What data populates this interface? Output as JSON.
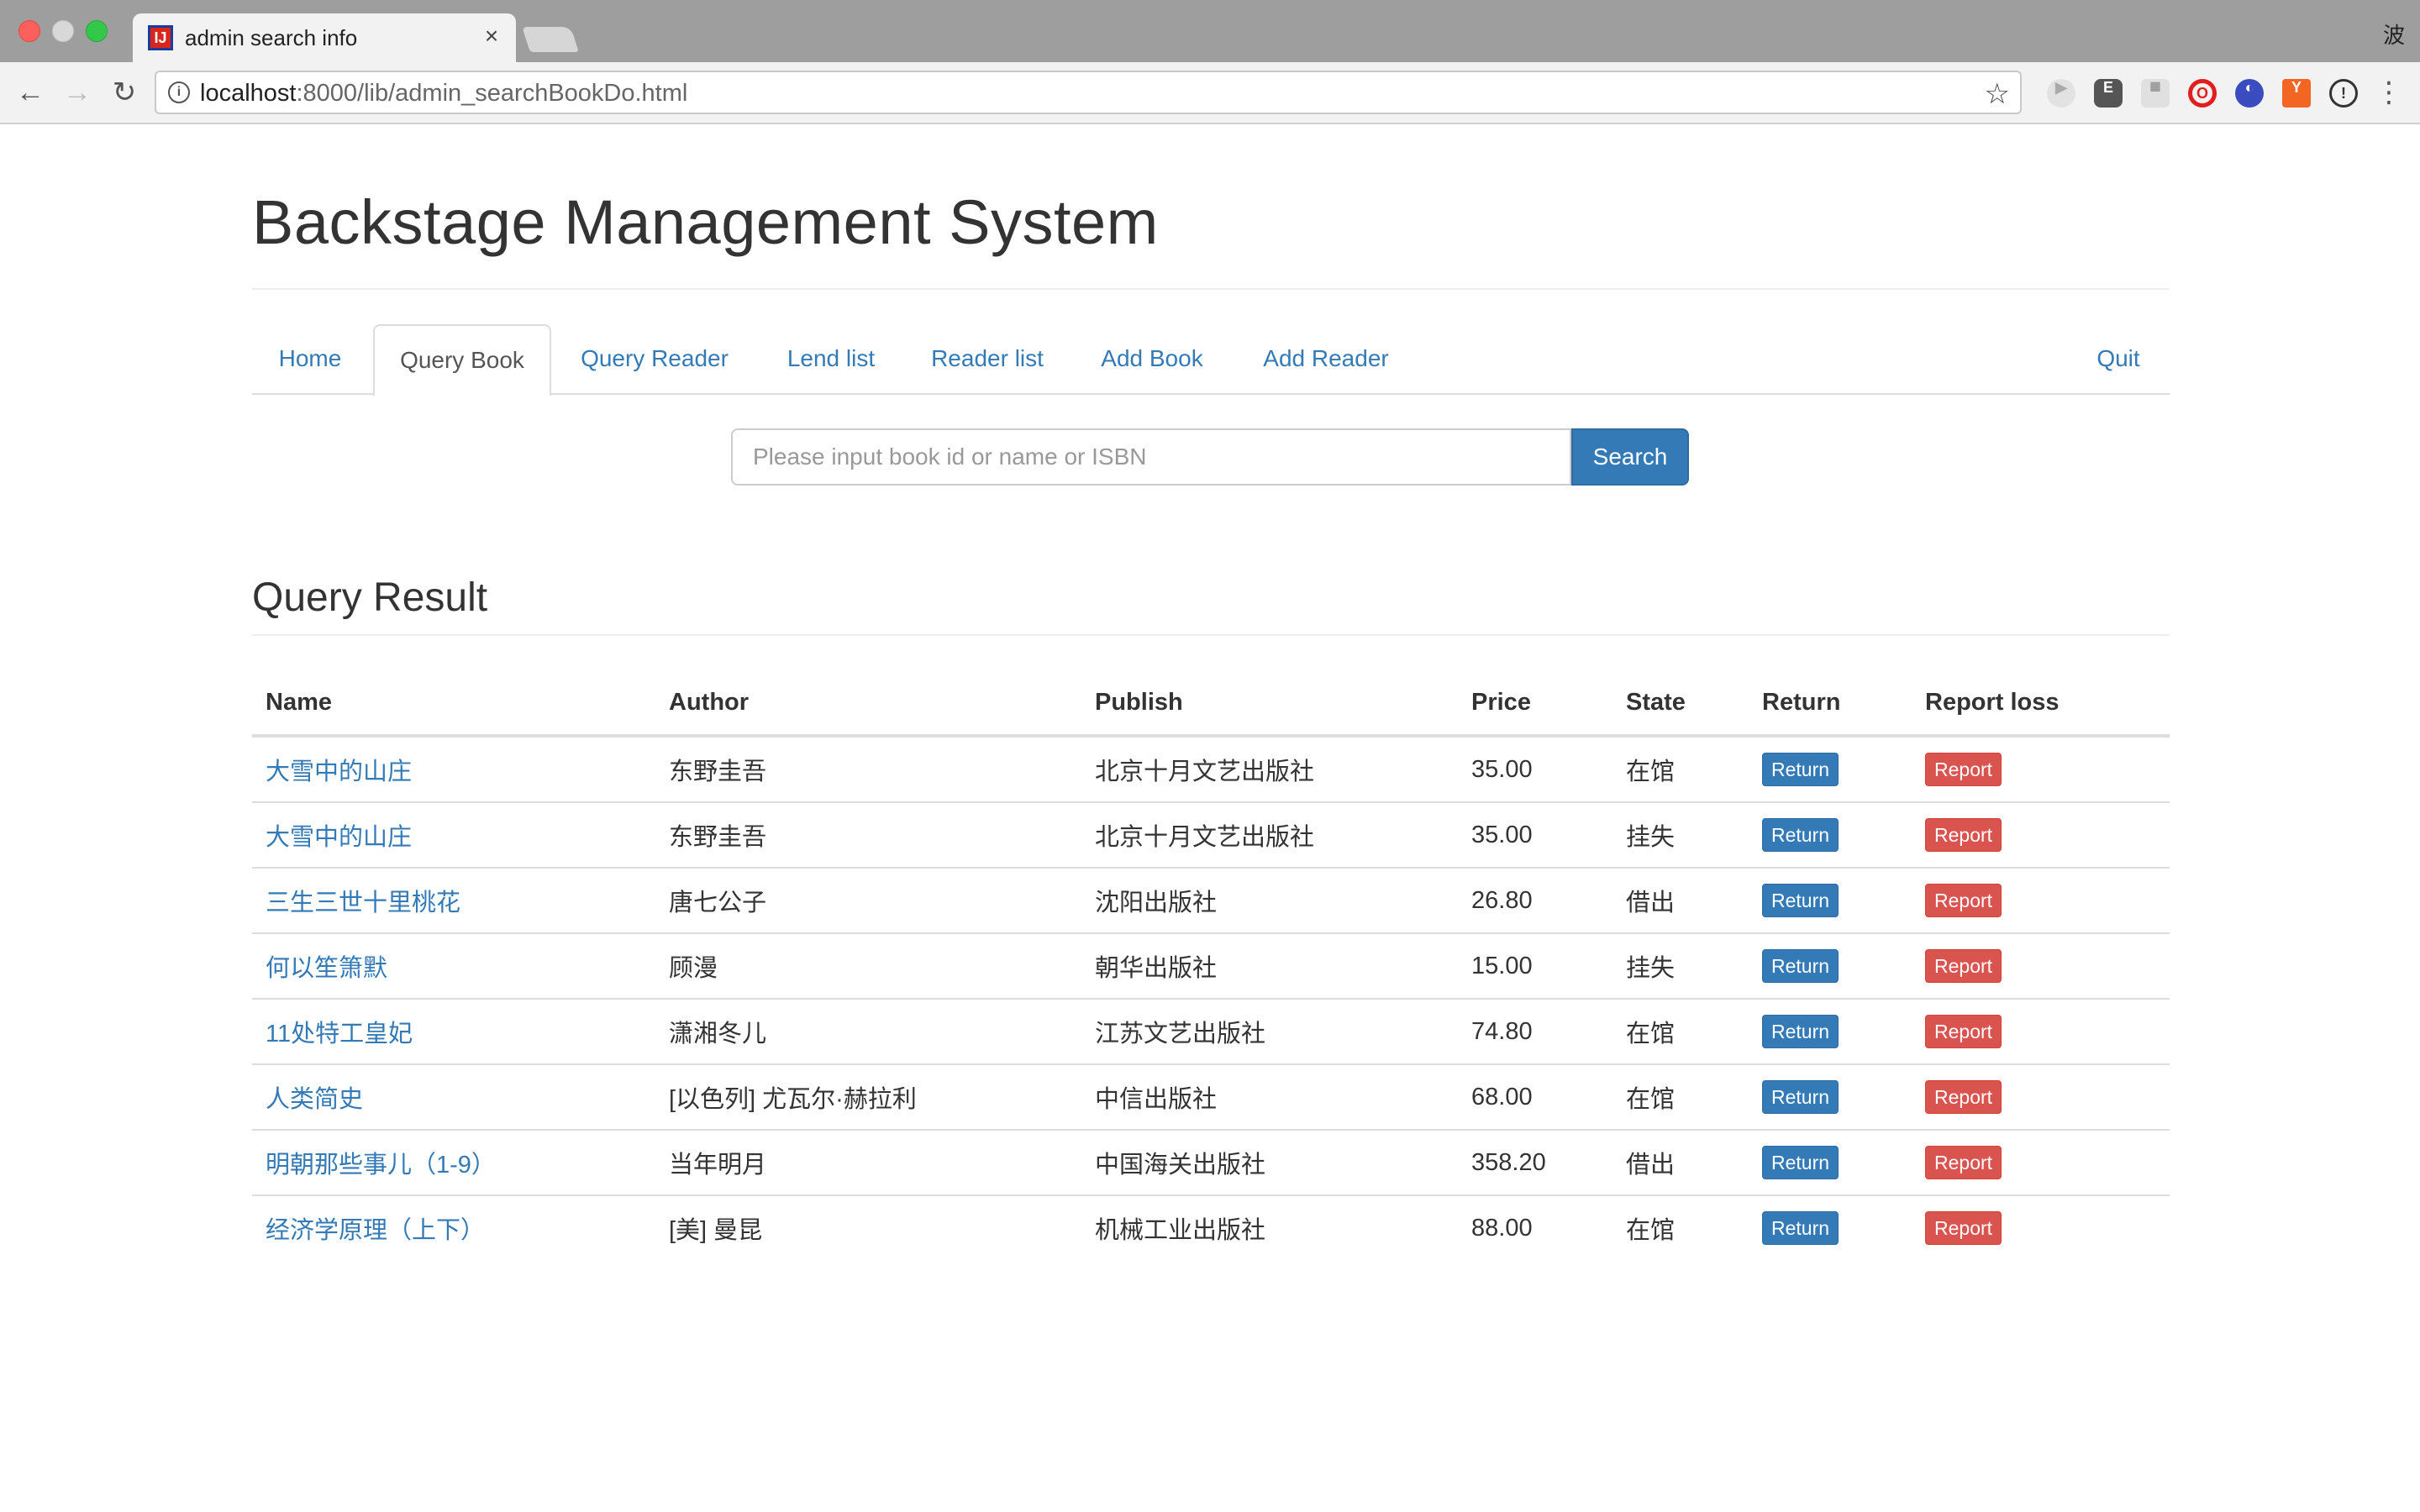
{
  "browser": {
    "tab_title": "admin search info",
    "url_host": "localhost",
    "url_rest": ":8000/lib/admin_searchBookDo.html",
    "profile_glyph": "波",
    "icons": [
      "back-icon",
      "forward-icon",
      "reload-icon",
      "info-icon",
      "star-icon",
      "menu-icon"
    ]
  },
  "header": {
    "title": "Backstage Management System"
  },
  "nav": {
    "items": [
      "Home",
      "Query Book",
      "Query Reader",
      "Lend list",
      "Reader list",
      "Add Book",
      "Add Reader"
    ],
    "active": "Query Book",
    "quit": "Quit",
    "link_color": "#337ab7"
  },
  "search": {
    "placeholder": "Please input book id or name or ISBN",
    "value": "",
    "button": "Search"
  },
  "results": {
    "title": "Query Result",
    "columns": [
      "Name",
      "Author",
      "Publish",
      "Price",
      "State",
      "Return",
      "Report loss"
    ],
    "rows": [
      {
        "name": "大雪中的山庄",
        "author": "东野圭吾",
        "publish": "北京十月文艺出版社",
        "price": "35.00",
        "state": "在馆"
      },
      {
        "name": "大雪中的山庄",
        "author": "东野圭吾",
        "publish": "北京十月文艺出版社",
        "price": "35.00",
        "state": "挂失"
      },
      {
        "name": "三生三世十里桃花",
        "author": "唐七公子",
        "publish": "沈阳出版社",
        "price": "26.80",
        "state": "借出"
      },
      {
        "name": "何以笙箫默",
        "author": "顾漫",
        "publish": "朝华出版社",
        "price": "15.00",
        "state": "挂失"
      },
      {
        "name": "11处特工皇妃",
        "author": "潇湘冬儿",
        "publish": "江苏文艺出版社",
        "price": "74.80",
        "state": "在馆"
      },
      {
        "name": "人类简史",
        "author": "[以色列] 尤瓦尔·赫拉利",
        "publish": "中信出版社",
        "price": "68.00",
        "state": "在馆"
      },
      {
        "name": "明朝那些事儿（1-9）",
        "author": "当年明月",
        "publish": "中国海关出版社",
        "price": "358.20",
        "state": "借出"
      },
      {
        "name": "经济学原理（上下）",
        "author": "[美] 曼昆",
        "publish": "机械工业出版社",
        "price": "88.00",
        "state": "在馆"
      }
    ],
    "return_label": "Return",
    "report_label": "Report",
    "colors": {
      "return": "#337ab7",
      "report": "#d9534f"
    }
  }
}
